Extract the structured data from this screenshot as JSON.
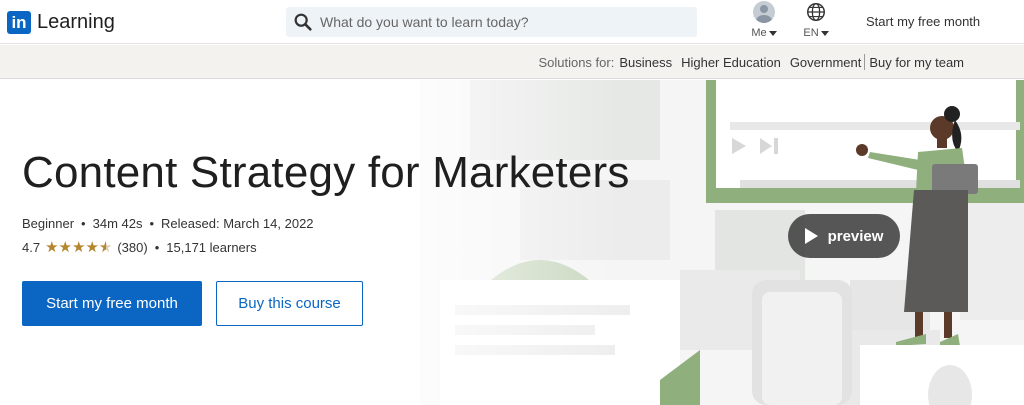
{
  "header": {
    "logo_mark": "in",
    "logo_text": "Learning",
    "search_placeholder": "What do you want to learn today?",
    "me_label": "Me",
    "lang_label": "EN",
    "start_label": "Start my free month"
  },
  "subnav": {
    "solutions_label": "Solutions for:",
    "items": [
      "Business",
      "Higher Education",
      "Government"
    ],
    "buy_team": "Buy for my team"
  },
  "course": {
    "title": "Content Strategy for Marketers",
    "level": "Beginner",
    "duration": "34m 42s",
    "released": "Released: March 14, 2022",
    "rating": "4.7",
    "rating_value": 4.7,
    "rating_count": "(380)",
    "learners": "15,171 learners",
    "primary_cta": "Start my free month",
    "secondary_cta": "Buy this course",
    "preview_label": "preview"
  },
  "colors": {
    "brand": "#0a66c2",
    "star": "#b5862d",
    "illustration_green": "#8fb07c"
  },
  "icons": [
    "search-icon",
    "avatar",
    "globe-icon",
    "caret-down-icon",
    "star-icon",
    "play-icon"
  ]
}
